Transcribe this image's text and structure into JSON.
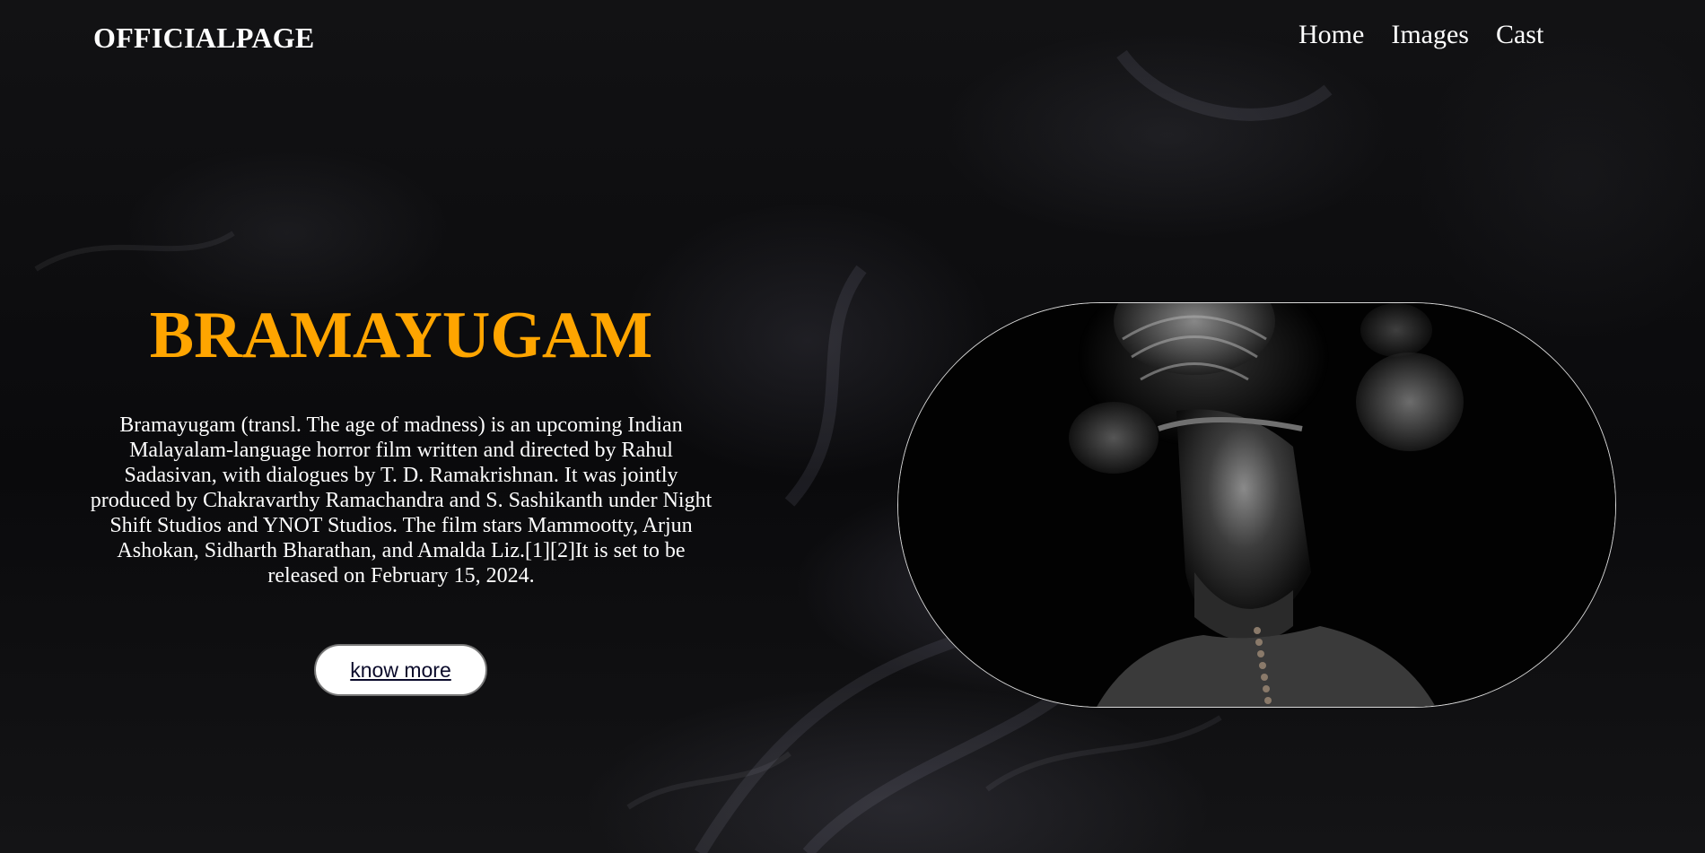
{
  "header": {
    "logo": "OFFICIALPAGE",
    "nav": [
      "Home",
      "Images",
      "Cast"
    ]
  },
  "hero": {
    "title": "BRAMAYUGAM",
    "description": "Bramayugam (transl. The age of madness) is an upcoming Indian Malayalam-language horror film written and directed by Rahul Sadasivan, with dialogues by T. D. Ramakrishnan. It was jointly produced by Chakravarthy Ramachandra and S. Sashikanth under Night Shift Studios and YNOT Studios. The film stars Mammootty, Arjun Ashokan, Sidharth Bharathan, and Amalda Liz.[1][2]It is set to be released on February 15, 2024.",
    "button_label": "know more"
  },
  "colors": {
    "title": "#ffa500",
    "text": "#ffffff",
    "background": "#0c0c0e"
  }
}
